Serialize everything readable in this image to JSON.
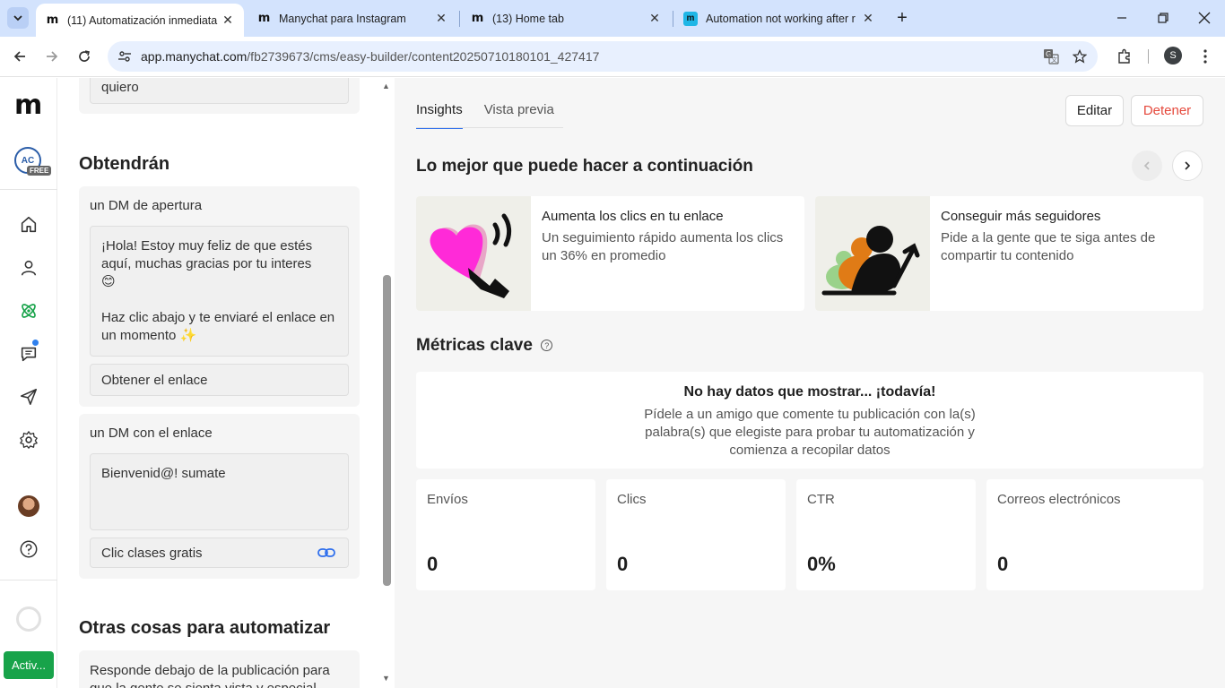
{
  "browser": {
    "tabs": [
      {
        "title": "(11) Automatización inmediata",
        "active": true,
        "favicon": "manychat-m-icon"
      },
      {
        "title": "Manychat para Instagram",
        "active": false,
        "favicon": "manychat-m-icon"
      },
      {
        "title": "(13) Home tab",
        "active": false,
        "favicon": "manychat-m-icon"
      },
      {
        "title": "Automation not working after r",
        "active": false,
        "favicon": "blue-m-icon"
      }
    ],
    "url_host": "app.manychat.com",
    "url_path": "/fb2739673/cms/easy-builder/content20250710180101_427417",
    "profile_initial": "S"
  },
  "nav": {
    "logo": "m",
    "account_initials": "AC",
    "account_badge": "FREE",
    "activate_label": "Activ..."
  },
  "left": {
    "top_field_text": "quiero",
    "obtendran_heading": "Obtendrán",
    "dm_opening": {
      "label": "un DM de apertura",
      "message_line1": "¡Hola! Estoy muy feliz de que estés aquí, muchas gracias por tu interes",
      "emoji1": "😊",
      "message_line2": "Haz clic abajo y te enviaré el enlace en un momento",
      "emoji2": "✨",
      "button_label": "Obtener el enlace"
    },
    "dm_link": {
      "label": "un DM con el enlace",
      "message": "Bienvenid@! sumate",
      "button_label": "Clic clases gratis"
    },
    "other_heading": "Otras cosas para automatizar",
    "other_item": "Responde debajo de la publicación para que la gente se sienta vista y especial"
  },
  "main": {
    "tabs": {
      "insights": "Insights",
      "preview": "Vista previa"
    },
    "edit_label": "Editar",
    "stop_label": "Detener",
    "best_next_heading": "Lo mejor que puede hacer a continuación",
    "suggestions": [
      {
        "title": "Aumenta los clics en tu enlace",
        "desc": "Un seguimiento rápido aumenta los clics un 36% en promedio"
      },
      {
        "title": "Conseguir más seguidores",
        "desc": "Pide a la gente que te siga antes de compartir tu contenido"
      }
    ],
    "metrics_heading": "Métricas clave",
    "nodata_title": "No hay datos que mostrar... ¡todavía!",
    "nodata_desc": "Pídele a un amigo que comente tu publicación con la(s) palabra(s) que elegiste para probar tu automatización y comienza a recopilar datos",
    "metrics": [
      {
        "label": "Envíos",
        "value": "0"
      },
      {
        "label": "Clics",
        "value": "0"
      },
      {
        "label": "CTR",
        "value": "0%"
      },
      {
        "label": "Correos electrónicos",
        "value": "0"
      }
    ]
  },
  "colors": {
    "accent_blue": "#2f6fed",
    "stop_red": "#e5483b",
    "activate_green": "#18a34a",
    "heart_pink": "#ff2ad8"
  }
}
